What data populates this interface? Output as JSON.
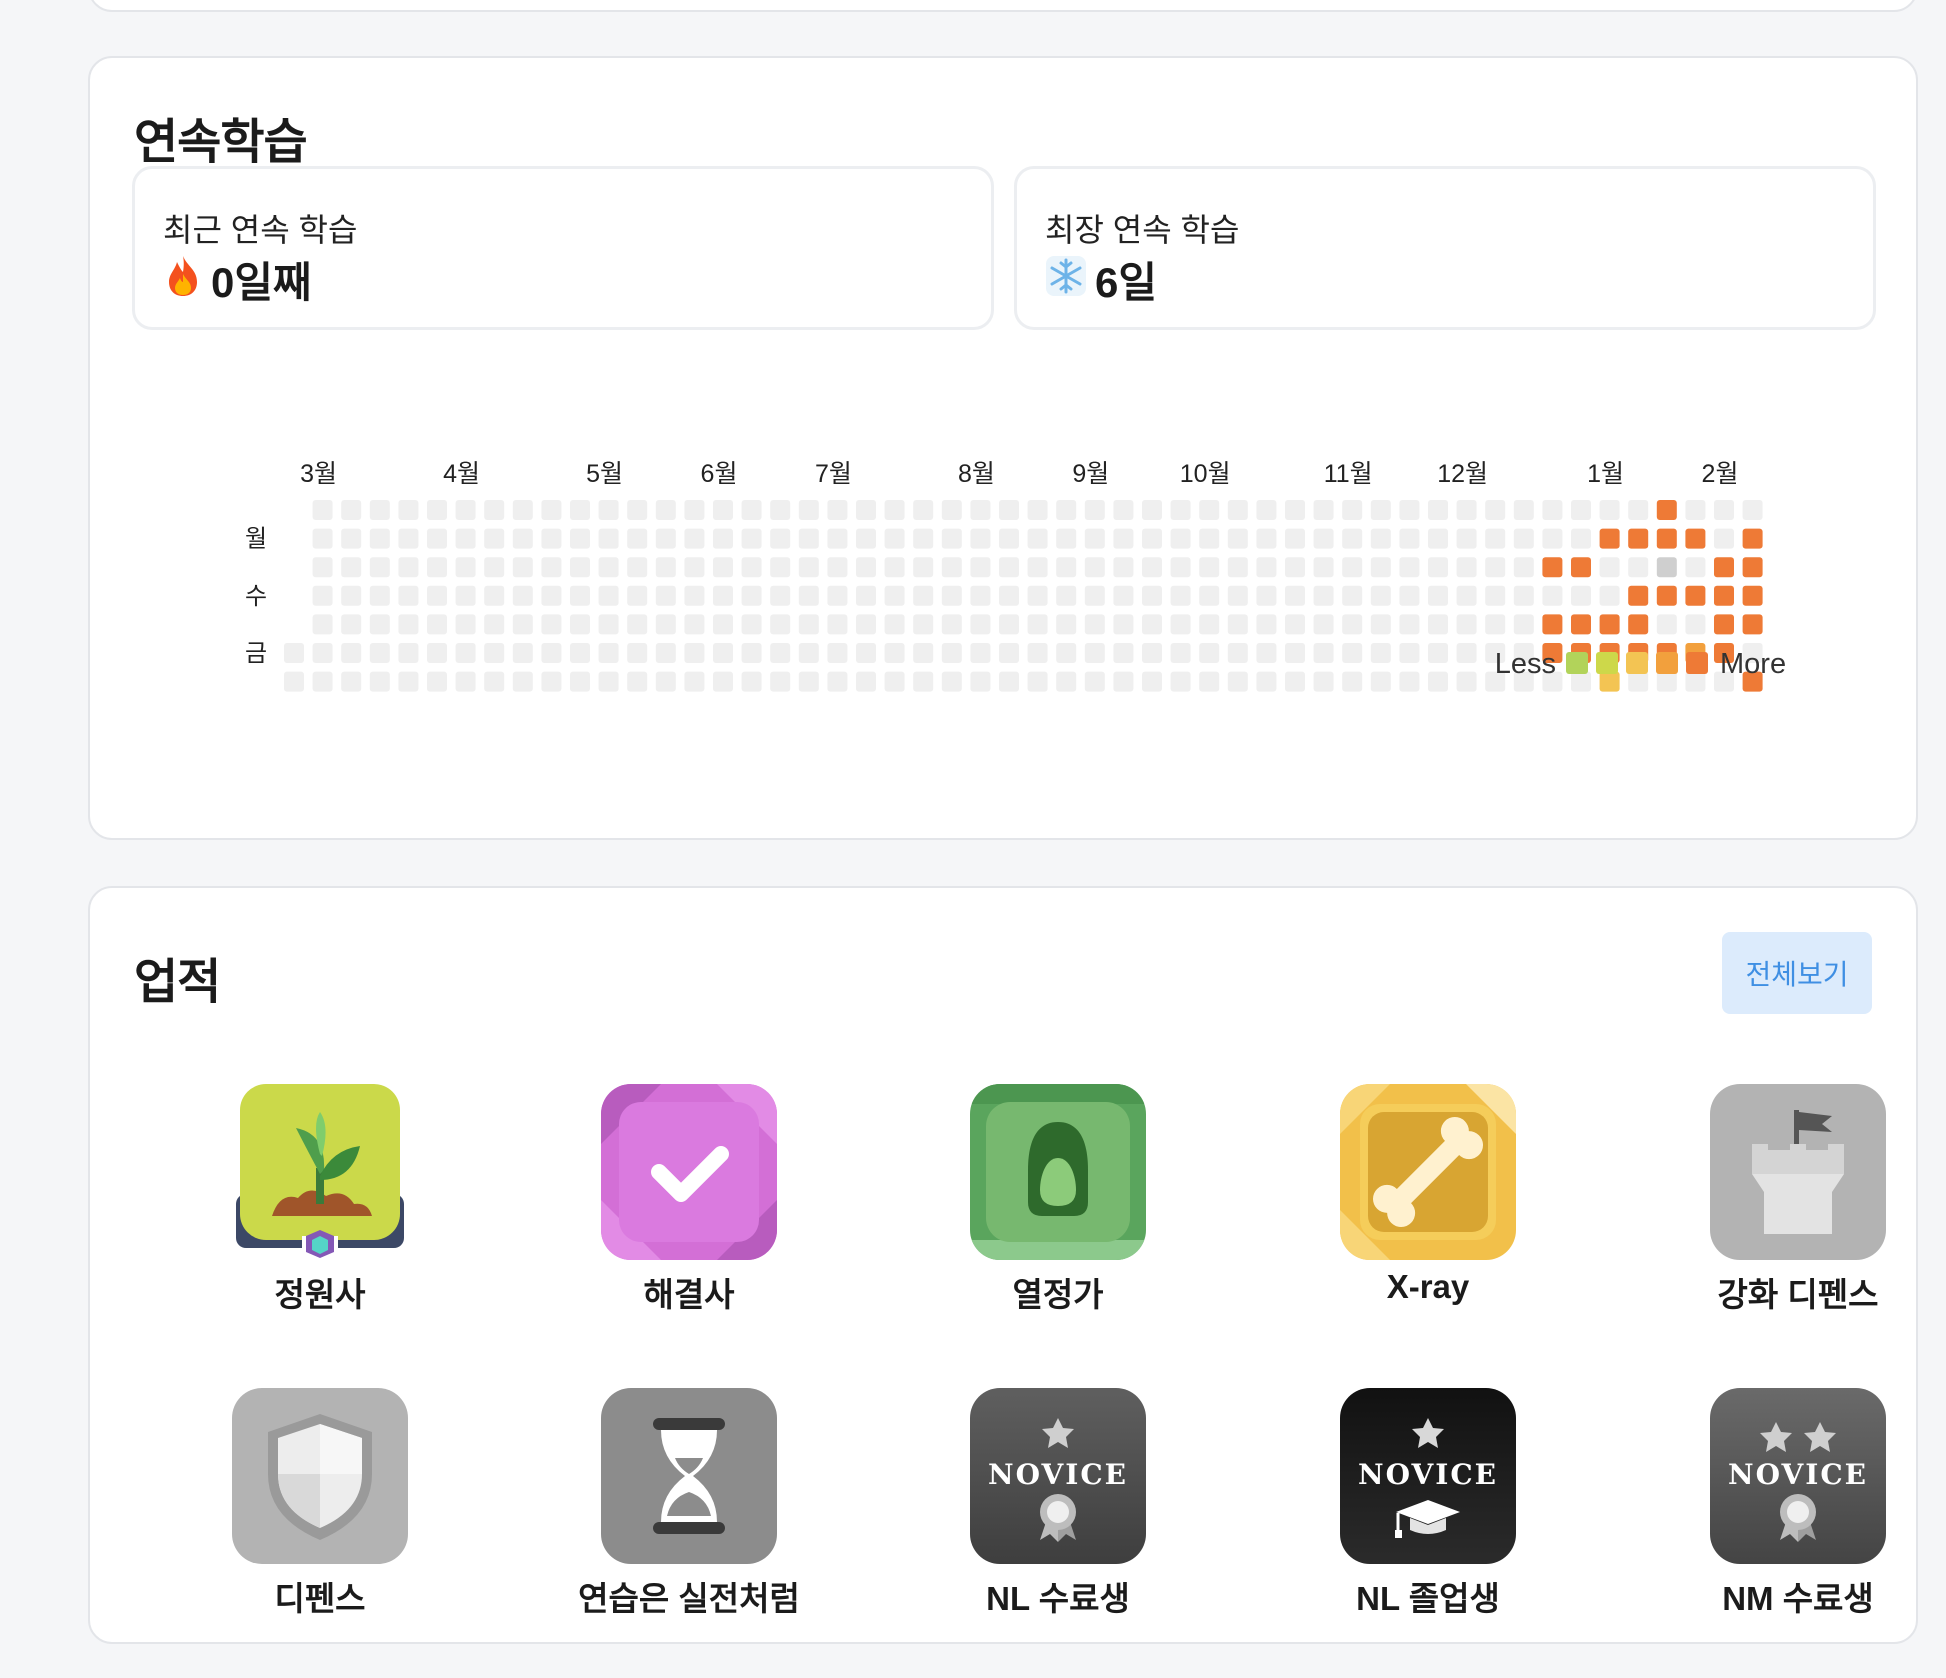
{
  "streak": {
    "title": "연속학습",
    "recent": {
      "label": "최근 연속 학습",
      "icon": "fire-icon",
      "value": "0일째"
    },
    "longest": {
      "label": "최장 연속 학습",
      "icon": "snowflake-icon",
      "value": "6일"
    },
    "months": [
      "3월",
      "4월",
      "5월",
      "6월",
      "7월",
      "8월",
      "9월",
      "10월",
      "11월",
      "12월",
      "1월",
      "2월"
    ],
    "day_labels": [
      "월",
      "수",
      "금"
    ],
    "legend": {
      "less": "Less",
      "more": "More"
    },
    "colors": {
      "empty": "#efefef",
      "level1": "#b2d35a",
      "level2": "#cdd84a",
      "level3": "#f3c453",
      "level4": "#f2a03d",
      "level5": "#ee7a36",
      "gray": "#cfcfcf"
    },
    "activity_note": "recent weeks only; earlier weeks empty",
    "recent_weeks": [
      [
        0,
        0,
        5,
        0,
        5,
        5,
        0
      ],
      [
        0,
        0,
        5,
        0,
        5,
        5,
        0
      ],
      [
        0,
        5,
        0,
        0,
        5,
        5,
        3
      ],
      [
        0,
        5,
        0,
        5,
        5,
        5,
        0
      ],
      [
        5,
        5,
        9,
        5,
        0,
        5,
        0
      ],
      [
        0,
        5,
        0,
        5,
        0,
        4,
        0
      ],
      [
        0,
        0,
        5,
        5,
        5,
        5,
        0
      ],
      [
        0,
        5,
        5,
        5,
        5,
        0,
        5
      ]
    ]
  },
  "achievements": {
    "title": "업적",
    "view_all_label": "전체보기",
    "items": [
      {
        "label": "정원사",
        "icon": "sprout-badge-icon"
      },
      {
        "label": "해결사",
        "icon": "checkmark-badge-icon"
      },
      {
        "label": "열정가",
        "icon": "avocado-badge-icon"
      },
      {
        "label": "X-ray",
        "icon": "bone-badge-icon"
      },
      {
        "label": "강화 디펜스",
        "icon": "castle-tower-badge-icon"
      },
      {
        "label": "디펜스",
        "icon": "shield-badge-icon"
      },
      {
        "label": "연습은 실전처럼",
        "icon": "hourglass-badge-icon"
      },
      {
        "label": "NL 수료생",
        "icon": "novice-medal-badge-icon",
        "badge_text": "NOVICE"
      },
      {
        "label": "NL 졸업생",
        "icon": "novice-graduate-badge-icon",
        "badge_text": "NOVICE"
      },
      {
        "label": "NM 수료생",
        "icon": "novice-two-star-badge-icon",
        "badge_text": "NOVICE"
      }
    ]
  }
}
